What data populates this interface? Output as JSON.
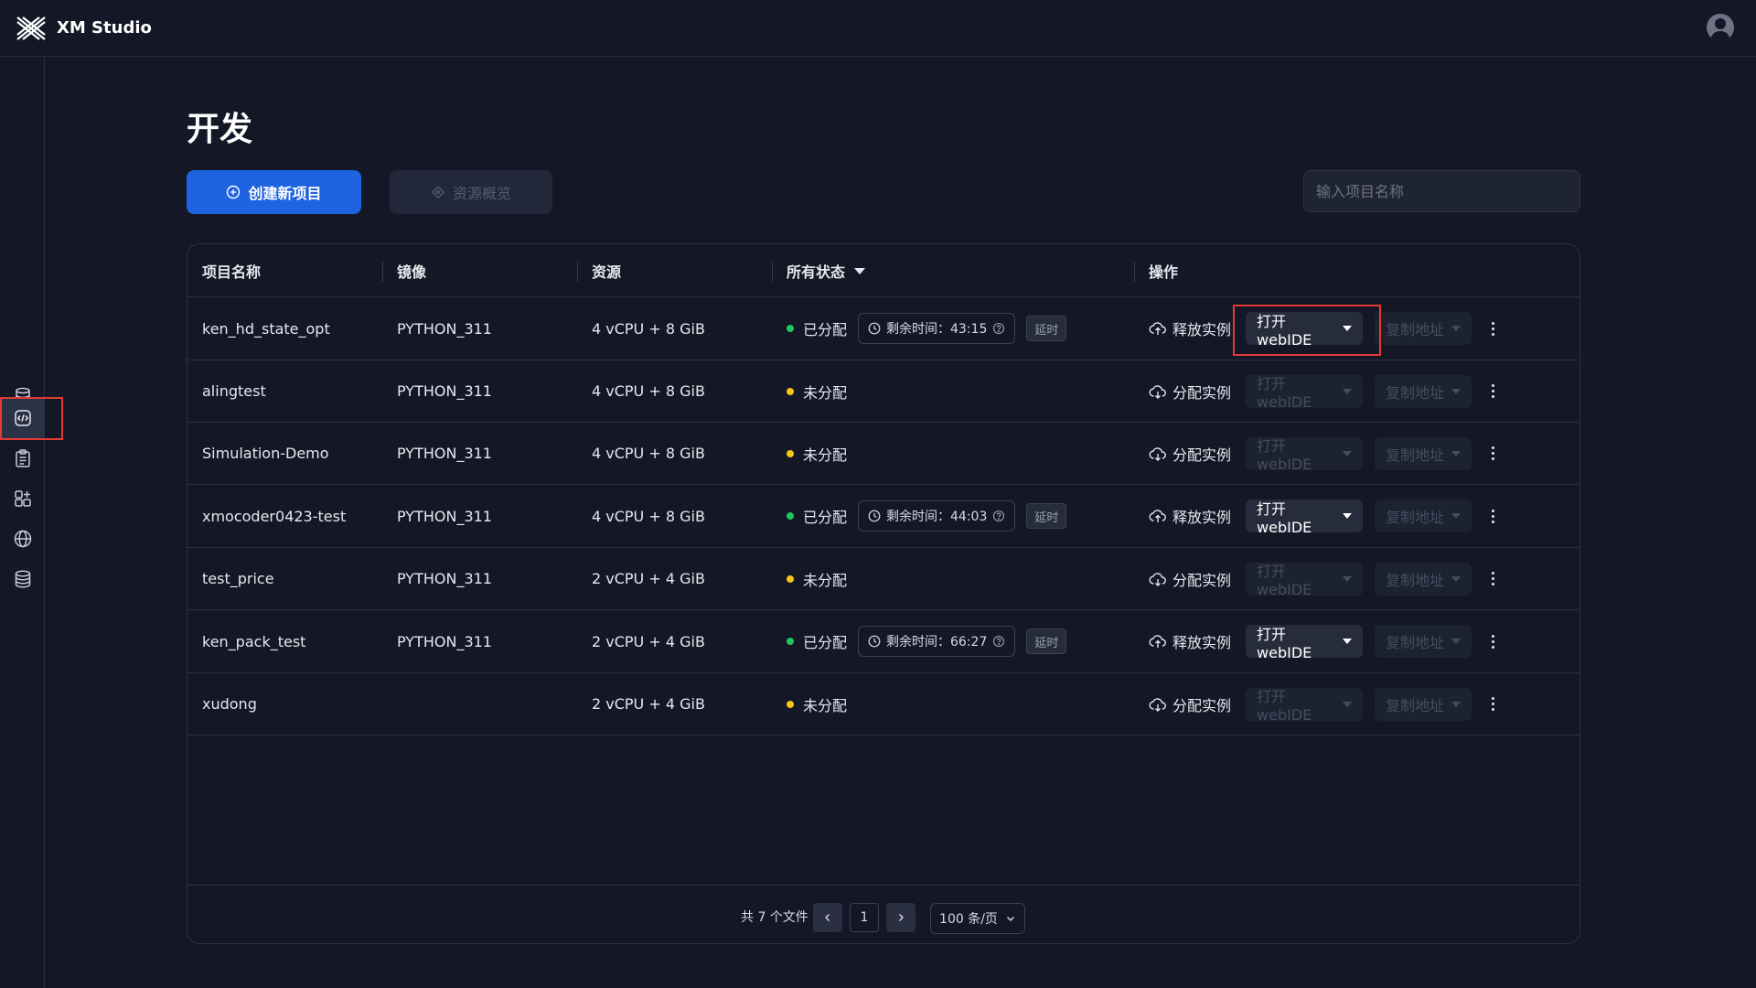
{
  "app": {
    "brand": "XM Studio"
  },
  "page": {
    "title": "开发"
  },
  "toolbar": {
    "create_label": "创建新项目",
    "overview_label": "资源概览",
    "search_placeholder": "输入项目名称"
  },
  "table": {
    "headers": {
      "name": "项目名称",
      "image": "镜像",
      "resource": "资源",
      "status": "所有状态",
      "actions": "操作"
    },
    "rows": [
      {
        "name": "ken_hd_state_opt",
        "image": "PYTHON_311",
        "resource": "4 vCPU + 8 GiB",
        "status": "已分配",
        "assigned": true,
        "timer": "剩余时间：43:15",
        "extend": "延时",
        "action": "释放实例",
        "webide": "打开webIDE",
        "copy": "复制地址"
      },
      {
        "name": "alingtest",
        "image": "PYTHON_311",
        "resource": "4 vCPU + 8 GiB",
        "status": "未分配",
        "assigned": false,
        "action": "分配实例",
        "webide": "打开webIDE",
        "copy": "复制地址"
      },
      {
        "name": "Simulation-Demo",
        "image": "PYTHON_311",
        "resource": "4 vCPU + 8 GiB",
        "status": "未分配",
        "assigned": false,
        "action": "分配实例",
        "webide": "打开webIDE",
        "copy": "复制地址"
      },
      {
        "name": "xmocoder0423-test",
        "image": "PYTHON_311",
        "resource": "4 vCPU + 8 GiB",
        "status": "已分配",
        "assigned": true,
        "timer": "剩余时间：44:03",
        "extend": "延时",
        "action": "释放实例",
        "webide": "打开webIDE",
        "copy": "复制地址"
      },
      {
        "name": "test_price",
        "image": "PYTHON_311",
        "resource": "2 vCPU + 4 GiB",
        "status": "未分配",
        "assigned": false,
        "action": "分配实例",
        "webide": "打开webIDE",
        "copy": "复制地址"
      },
      {
        "name": "ken_pack_test",
        "image": "PYTHON_311",
        "resource": "2 vCPU + 4 GiB",
        "status": "已分配",
        "assigned": true,
        "timer": "剩余时间：66:27",
        "extend": "延时",
        "action": "释放实例",
        "webide": "打开webIDE",
        "copy": "复制地址"
      },
      {
        "name": "xudong",
        "image": "",
        "resource": "2 vCPU + 4 GiB",
        "status": "未分配",
        "assigned": false,
        "action": "分配实例",
        "webide": "打开webIDE",
        "copy": "复制地址"
      }
    ]
  },
  "pagination": {
    "total": "共 7 个文件",
    "page": "1",
    "page_size": "100 条/页"
  },
  "sidebar": {
    "items": [
      {
        "icon": "cylinder-icon"
      },
      {
        "icon": "code-icon",
        "active": true
      },
      {
        "icon": "clipboard-icon"
      },
      {
        "icon": "apps-icon"
      },
      {
        "icon": "globe-icon"
      },
      {
        "icon": "database-icon"
      }
    ]
  },
  "colors": {
    "background": "#141826",
    "primary": "#1e63e0",
    "assigned": "#22c55e",
    "unassigned": "#f5c518",
    "highlight": "#e53935"
  }
}
